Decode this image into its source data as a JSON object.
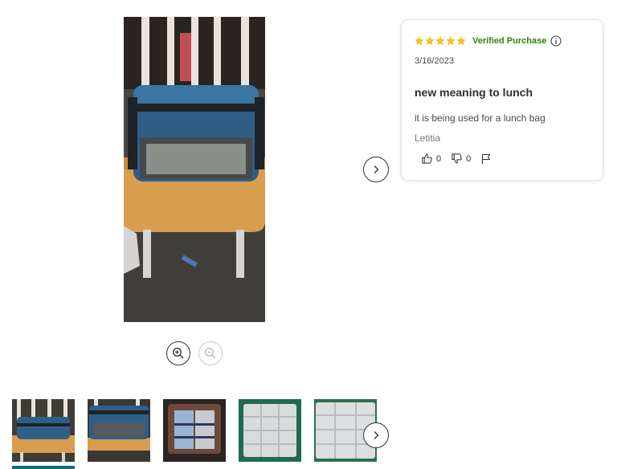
{
  "review": {
    "rating": 5,
    "max_rating": 5,
    "verified_label": "Verified Purchase",
    "date": "3/16/2023",
    "title": "new meaning to lunch",
    "body": "it is being used for a lunch bag",
    "author": "Letitia",
    "helpful_count": "0",
    "unhelpful_count": "0"
  },
  "media": {
    "main_image_alt": "blue tackle bag on wooden chair",
    "thumbnails": [
      {
        "alt": "bag on chair front view"
      },
      {
        "alt": "bag on chair angle view"
      },
      {
        "alt": "bag interior with boxes"
      },
      {
        "alt": "clear tackle box"
      },
      {
        "alt": "clear tackle box open"
      }
    ]
  },
  "icons": {
    "zoom_in": "zoom-in-icon",
    "zoom_out": "zoom-out-icon",
    "next": "chevron-right-icon",
    "thumbs_up": "thumbs-up-icon",
    "thumbs_down": "thumbs-down-icon",
    "flag": "flag-icon",
    "info": "info-icon",
    "star": "star-icon"
  },
  "colors": {
    "verified": "#2a8703",
    "star": "#ffc220",
    "text": "#2e2f32",
    "thumb_selected": "#0b6e7a"
  }
}
